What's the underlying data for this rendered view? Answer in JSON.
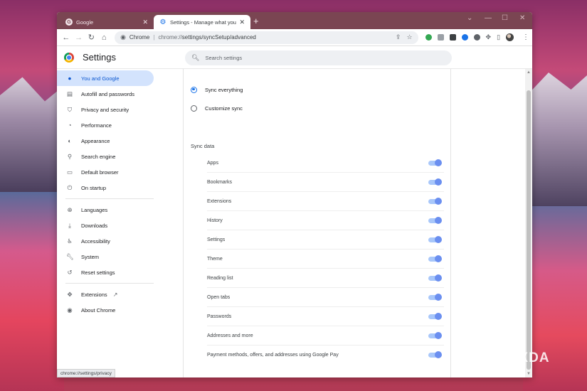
{
  "browser": {
    "tabs": [
      {
        "title": "Google",
        "active": false
      },
      {
        "title": "Settings - Manage what you sync",
        "active": true
      }
    ],
    "new_tab_symbol": "+",
    "omnibox": {
      "site_label": "Chrome",
      "url_host": "chrome://",
      "url_path": "settings/syncSetup/advanced"
    },
    "status_bubble": "chrome://settings/privacy"
  },
  "settings": {
    "title": "Settings",
    "search_placeholder": "Search settings",
    "sidebar": {
      "group1": [
        {
          "label": "You and Google",
          "icon": "person-icon",
          "active": true
        },
        {
          "label": "Autofill and passwords",
          "icon": "clipboard-icon"
        },
        {
          "label": "Privacy and security",
          "icon": "shield-icon"
        },
        {
          "label": "Performance",
          "icon": "speedometer-icon"
        },
        {
          "label": "Appearance",
          "icon": "palette-icon"
        },
        {
          "label": "Search engine",
          "icon": "search-icon"
        },
        {
          "label": "Default browser",
          "icon": "browser-icon"
        },
        {
          "label": "On startup",
          "icon": "power-icon"
        }
      ],
      "group2": [
        {
          "label": "Languages",
          "icon": "globe-icon"
        },
        {
          "label": "Downloads",
          "icon": "download-icon"
        },
        {
          "label": "Accessibility",
          "icon": "accessibility-icon"
        },
        {
          "label": "System",
          "icon": "wrench-icon"
        },
        {
          "label": "Reset settings",
          "icon": "history-icon"
        }
      ],
      "group3": [
        {
          "label": "Extensions",
          "icon": "puzzle-icon"
        },
        {
          "label": "About Chrome",
          "icon": "chrome-icon"
        }
      ]
    },
    "sync": {
      "options": [
        {
          "label": "Sync everything",
          "checked": true
        },
        {
          "label": "Customize sync",
          "checked": false
        }
      ],
      "section_label": "Sync data",
      "items": [
        {
          "label": "Apps",
          "enabled": true
        },
        {
          "label": "Bookmarks",
          "enabled": true
        },
        {
          "label": "Extensions",
          "enabled": true
        },
        {
          "label": "History",
          "enabled": true
        },
        {
          "label": "Settings",
          "enabled": true
        },
        {
          "label": "Theme",
          "enabled": true
        },
        {
          "label": "Reading list",
          "enabled": true
        },
        {
          "label": "Open tabs",
          "enabled": true
        },
        {
          "label": "Passwords",
          "enabled": true
        },
        {
          "label": "Addresses and more",
          "enabled": true
        },
        {
          "label": "Payment methods, offers, and addresses using Google Pay",
          "enabled": true
        }
      ]
    }
  },
  "watermark": "XDA",
  "colors": {
    "accent": "#1a73e8",
    "active_nav_bg": "#d3e3fd",
    "toggle_on": "#a8c7fa",
    "tabstrip": "#7a4552"
  }
}
